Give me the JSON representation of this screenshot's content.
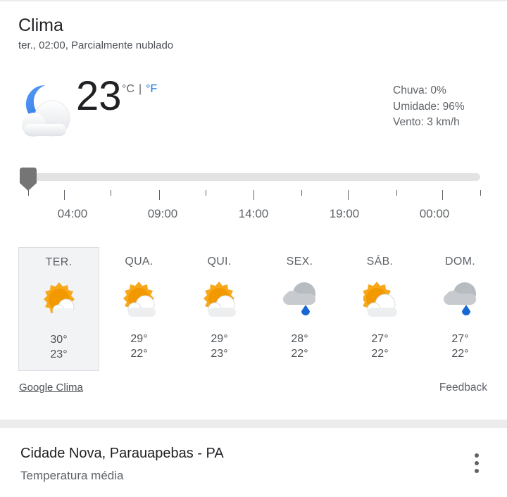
{
  "header": {
    "title": "Clima",
    "subtitle": "ter., 02:00, Parcialmente nublado"
  },
  "current": {
    "icon": "moon-partly-cloudy-icon",
    "temperature": "23",
    "unit_c": "°C",
    "unit_sep": "|",
    "unit_f": "°F",
    "rain": "Chuva: 0%",
    "humidity": "Umidade: 96%",
    "wind": "Vento: 3 km/h"
  },
  "timeline": {
    "position": 0,
    "labels": [
      "04:00",
      "09:00",
      "14:00",
      "19:00",
      "00:00"
    ]
  },
  "forecast": [
    {
      "day": "TER.",
      "hi": "30°",
      "lo": "23°",
      "icon": "sun-partly-cloudy-icon",
      "selected": true
    },
    {
      "day": "QUA.",
      "hi": "29°",
      "lo": "22°",
      "icon": "sun-partly-cloudy-icon",
      "selected": false
    },
    {
      "day": "QUI.",
      "hi": "29°",
      "lo": "23°",
      "icon": "sun-partly-cloudy-icon",
      "selected": false
    },
    {
      "day": "SEX.",
      "hi": "28°",
      "lo": "22°",
      "icon": "rain-cloud-icon",
      "selected": false
    },
    {
      "day": "SÁB.",
      "hi": "27°",
      "lo": "22°",
      "icon": "sun-partly-cloudy-icon",
      "selected": false
    },
    {
      "day": "DOM.",
      "hi": "27°",
      "lo": "22°",
      "icon": "rain-cloud-icon",
      "selected": false
    }
  ],
  "footer": {
    "source_link": "Google Clima",
    "feedback": "Feedback"
  },
  "location_card": {
    "location": "Cidade Nova, Parauapebas - PA",
    "subtitle": "Temperatura média",
    "more_icon": "more-vert-icon"
  },
  "colors": {
    "accent": "#1a73e8",
    "sun": "#f29900",
    "rain": "#1967d2",
    "moon": "#4285f4"
  }
}
